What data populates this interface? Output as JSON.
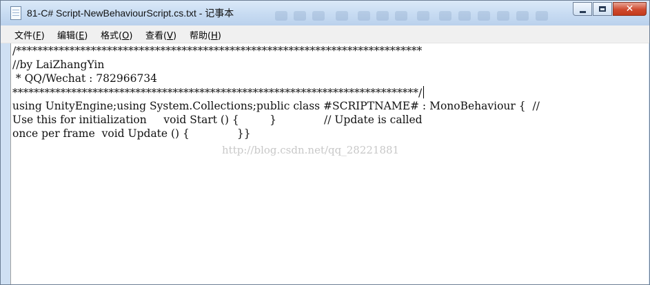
{
  "window": {
    "title": "81-C# Script-NewBehaviourScript.cs.txt - 记事本",
    "close_glyph": "✕"
  },
  "menu": {
    "file": {
      "label": "文件(",
      "key": "F",
      "end": ")"
    },
    "edit": {
      "label": "编辑(",
      "key": "E",
      "end": ")"
    },
    "format": {
      "label": "格式(",
      "key": "O",
      "end": ")"
    },
    "view": {
      "label": "查看(",
      "key": "V",
      "end": ")"
    },
    "help": {
      "label": "帮助(",
      "key": "H",
      "end": ")"
    }
  },
  "editor": {
    "lines": [
      "/****************************************************************************",
      "//by LaiZhangYin",
      " * QQ/Wechat : 782966734",
      "****************************************************************************/",
      "using UnityEngine;using System.Collections;public class #SCRIPTNAME# : MonoBehaviour {  //",
      "Use this for initialization     void Start () {         }              // Update is called",
      "once per frame  void Update () {              }}"
    ]
  },
  "watermark": "http://blog.csdn.net/qq_28221881"
}
